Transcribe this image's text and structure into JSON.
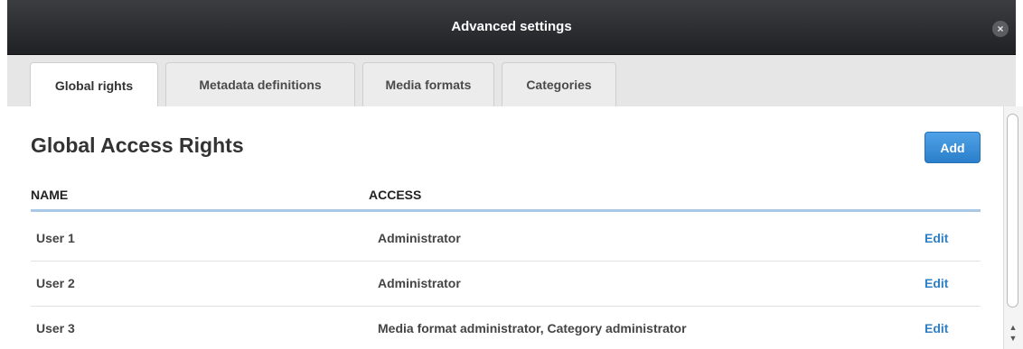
{
  "window": {
    "title": "Advanced settings",
    "close_glyph": "×"
  },
  "tabs": [
    {
      "label": "Global rights",
      "active": true
    },
    {
      "label": "Metadata definitions",
      "active": false
    },
    {
      "label": "Media formats",
      "active": false
    },
    {
      "label": "Categories",
      "active": false
    }
  ],
  "panel": {
    "heading": "Global Access Rights",
    "add_label": "Add",
    "columns": {
      "name": "NAME",
      "access": "ACCESS"
    },
    "rows": [
      {
        "name": "User 1",
        "access": "Administrator",
        "action": "Edit"
      },
      {
        "name": "User 2",
        "access": "Administrator",
        "action": "Edit"
      },
      {
        "name": "User 3",
        "access": "Media format administrator, Category administrator",
        "action": "Edit"
      }
    ]
  },
  "scrollbar": {
    "up_glyph": "▲",
    "down_glyph": "▼"
  },
  "colors": {
    "accent": "#2e7fc5",
    "button": "#3b8fd8",
    "titlebar": "#2a2c2f",
    "rule": "#a8c8e6"
  }
}
